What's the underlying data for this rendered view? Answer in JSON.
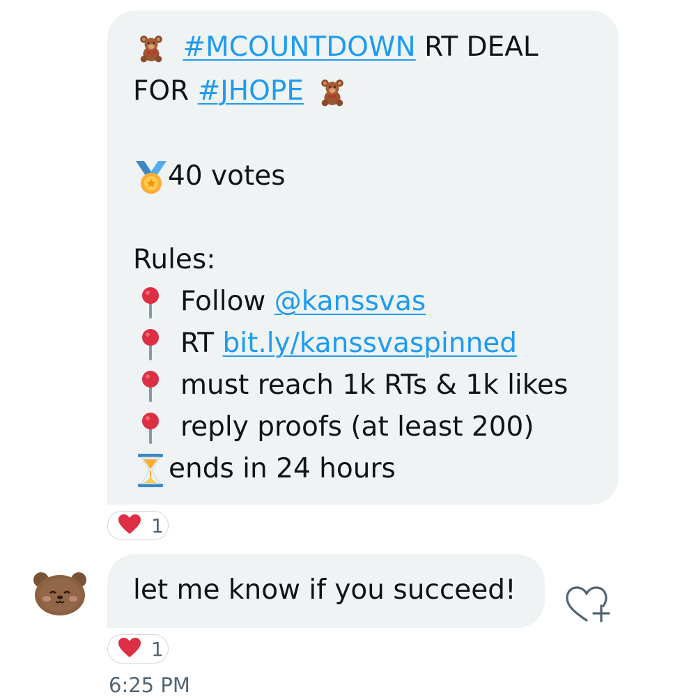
{
  "messages": [
    {
      "lines": {
        "l1_link": "#MCOUNTDOWN",
        "l1_text": " RT DEAL",
        "l2_text": "FOR ",
        "l2_link": "#JHOPE",
        "l4_text": "40 votes",
        "l6_text": "Rules:",
        "l7_text": "Follow ",
        "l7_link": "@kanssvas",
        "l8_text": "RT ",
        "l8_link": "bit.ly/kanssvaspinned",
        "l9_text": "must reach 1k RTs & 1k likes",
        "l10_text": "reply proofs (at least 200)",
        "l11_text": "ends in 24 hours"
      },
      "reaction_count": "1"
    },
    {
      "text": "let me know if you succeed!",
      "reaction_count": "1"
    }
  ],
  "timestamp": "6:25 PM",
  "icons": {
    "teddy": "teddy-bear-icon",
    "medal": "medal-icon",
    "pin": "round-pushpin-icon",
    "hourglass": "hourglass-icon",
    "heart": "red-heart-icon",
    "add_reaction": "heart-plus-icon",
    "avatar": "bear-avatar"
  },
  "colors": {
    "bubble": "#eff3f4",
    "link": "#1d9bf0",
    "heart": "#e0245e",
    "text": "#0f1419",
    "muted": "#536471"
  }
}
